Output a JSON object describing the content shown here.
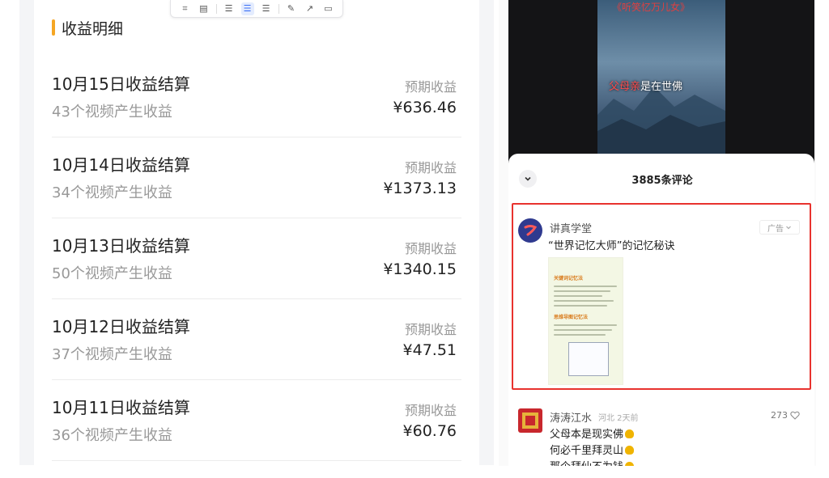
{
  "earnings": {
    "title": "收益明细",
    "rows": [
      {
        "title": "10月15日收益结算",
        "subtitle": "43个视频产生收益",
        "label": "预期收益",
        "amount": "¥636.46"
      },
      {
        "title": "10月14日收益结算",
        "subtitle": "34个视频产生收益",
        "label": "预期收益",
        "amount": "¥1373.13"
      },
      {
        "title": "10月13日收益结算",
        "subtitle": "50个视频产生收益",
        "label": "预期收益",
        "amount": "¥1340.15"
      },
      {
        "title": "10月12日收益结算",
        "subtitle": "37个视频产生收益",
        "label": "预期收益",
        "amount": "¥47.51"
      },
      {
        "title": "10月11日收益结算",
        "subtitle": "36个视频产生收益",
        "label": "预期收益",
        "amount": "¥60.76"
      }
    ]
  },
  "toolbar": {
    "icons": [
      "crop-icon",
      "note-icon",
      "align-left-icon",
      "align-center-icon",
      "align-right-icon",
      "edit-icon",
      "share-icon",
      "comment-icon"
    ]
  },
  "video": {
    "top_text": "《听笑忆万儿女》",
    "caption_red": "父母亲",
    "caption_rest": "是在世佛"
  },
  "comments": {
    "count": "3885条评论",
    "ad": {
      "author": "讲真学堂",
      "tag": "广告",
      "text": "“世界记忆大师”的记忆秘诀",
      "image_heading_1": "关键词记忆法",
      "image_heading_2": "思维导图记忆法"
    },
    "items": [
      {
        "author": "涛涛江水",
        "meta": "河北 2天前",
        "likes": "273",
        "lines": [
          "父母本是现实佛",
          "何必千里拜灵山",
          "那个拜仙不为钱"
        ]
      }
    ]
  },
  "colors": {
    "accent": "#f5a623",
    "highlight_border": "#e8322e",
    "toolbar_active": "#3b6ff5"
  }
}
